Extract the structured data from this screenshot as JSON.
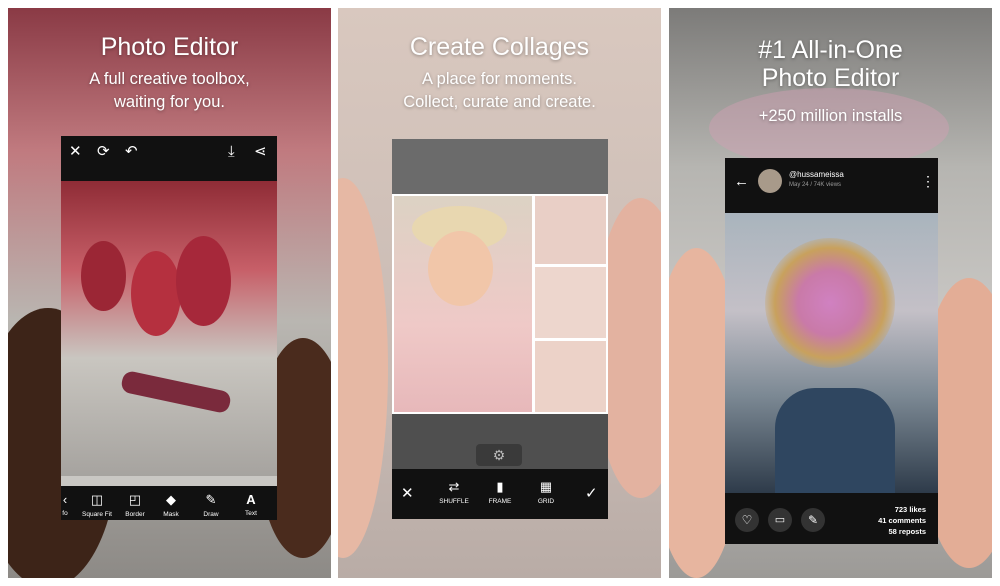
{
  "panels": [
    {
      "title": "Photo Editor",
      "subtitle1": "A full creative toolbox,",
      "subtitle2": "waiting for you."
    },
    {
      "title": "Create Collages",
      "subtitle1": "A place for moments.",
      "subtitle2": "Collect, curate and create."
    },
    {
      "title": "#1 All-in-One",
      "title2": "Photo Editor",
      "subtitle1": "+250 million installs"
    }
  ],
  "editor": {
    "tools": [
      {
        "label": "Square Fit",
        "icon": "square-fit-icon"
      },
      {
        "label": "Border",
        "icon": "border-icon"
      },
      {
        "label": "Mask",
        "icon": "mask-icon"
      },
      {
        "label": "Draw",
        "icon": "draw-icon"
      },
      {
        "label": "Text",
        "icon": "text-icon"
      }
    ],
    "partial_label": "fo"
  },
  "collage": {
    "tools": [
      {
        "label": "SHUFFLE",
        "icon": "shuffle-icon"
      },
      {
        "label": "FRAME",
        "icon": "frame-icon"
      },
      {
        "label": "GRID",
        "icon": "grid-icon"
      }
    ]
  },
  "post": {
    "username": "@hussameissa",
    "meta": "May 24 / 74K views",
    "likes": "723 likes",
    "comments": "41 comments",
    "reposts": "58 reposts"
  },
  "colors": {
    "topbar": "#111111",
    "balloon": "#b5303f"
  }
}
